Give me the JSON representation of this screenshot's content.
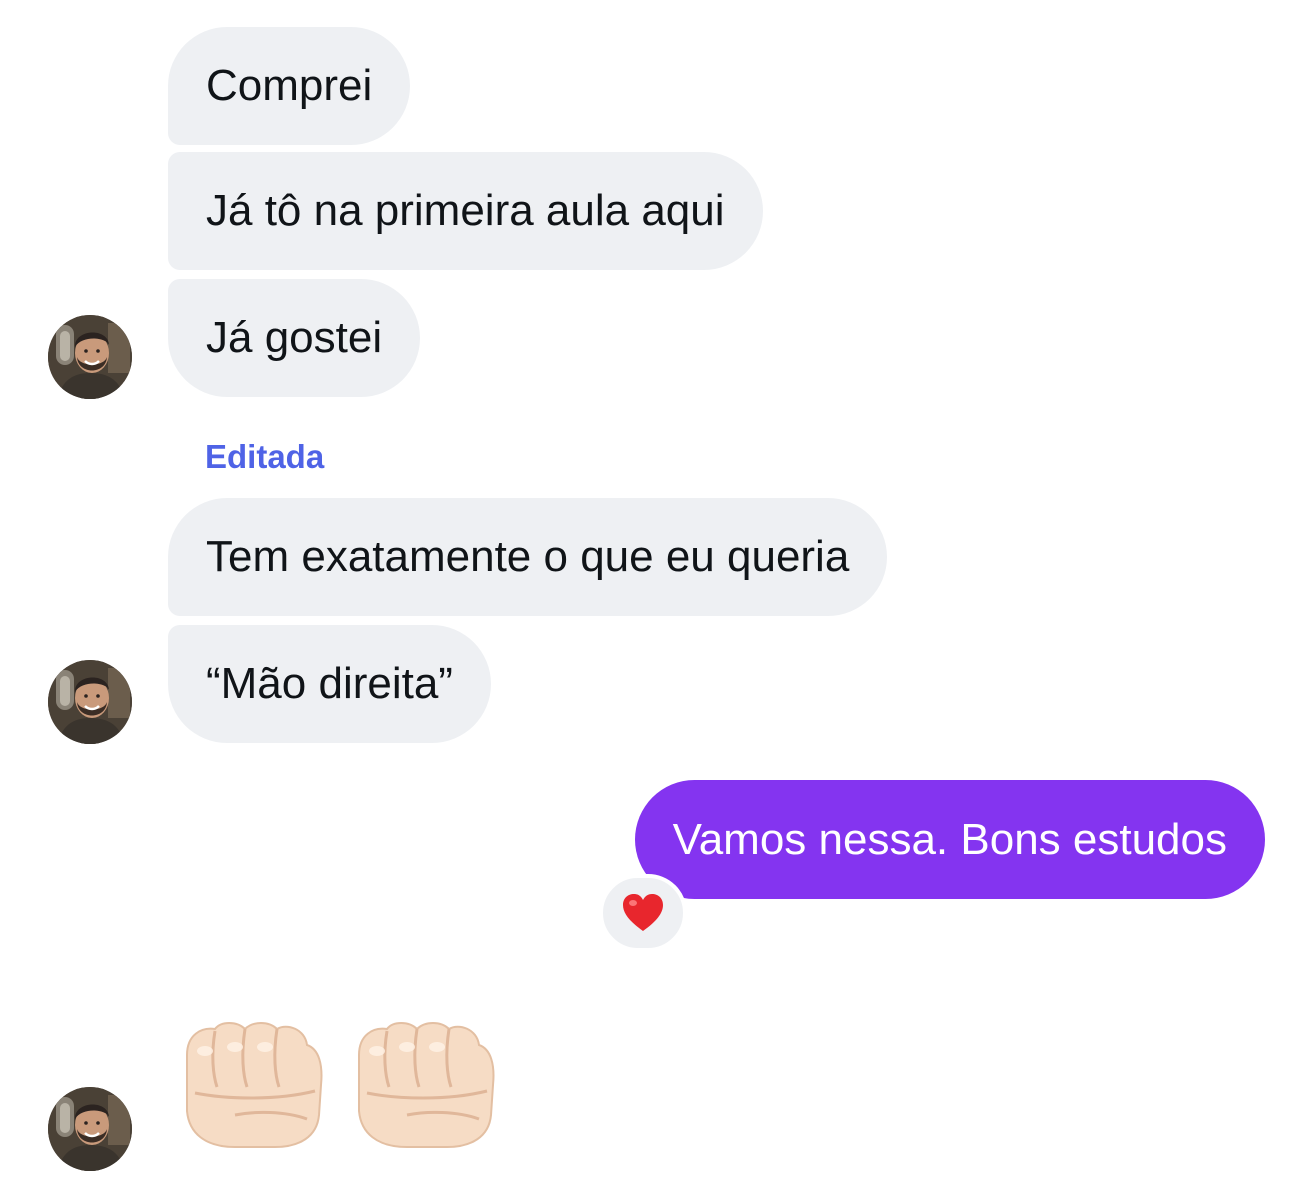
{
  "messages": {
    "incoming": [
      {
        "text": "Comprei"
      },
      {
        "text": "Já tô na primeira aula aqui"
      },
      {
        "text": "Já gostei"
      },
      {
        "text": "Tem exatamente o que eu queria"
      },
      {
        "text": "“Mão direita”"
      }
    ],
    "edited_label": "Editada",
    "outgoing": {
      "text": "Vamos nessa. Bons estudos",
      "reaction": "heart-icon"
    },
    "emoji_message": [
      "oncoming-fist-icon",
      "oncoming-fist-icon"
    ]
  },
  "colors": {
    "incoming_bubble": "#eef0f3",
    "outgoing_bubble": "#8434f0",
    "edited_label": "#4f63e6",
    "text": "#101418"
  }
}
